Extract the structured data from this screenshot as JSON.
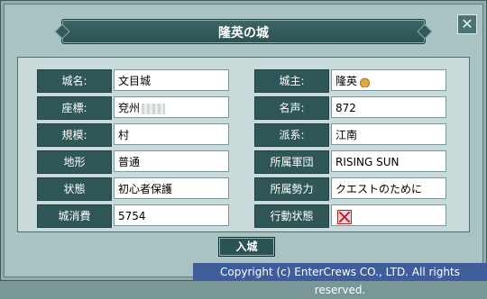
{
  "window": {
    "title": "隆英の城",
    "close_glyph": "✕"
  },
  "fields_left": [
    {
      "label": "城名:",
      "value": "文目城"
    },
    {
      "label": "座標:",
      "value": "兗州"
    },
    {
      "label": "規模:",
      "value": "村"
    },
    {
      "label": "地形",
      "value": "普通"
    },
    {
      "label": "状態",
      "value": "初心者保護"
    },
    {
      "label": "城消費",
      "value": "5754"
    }
  ],
  "fields_right": [
    {
      "label": "城主:",
      "value": "隆英"
    },
    {
      "label": "名声:",
      "value": "872"
    },
    {
      "label": "派系:",
      "value": "江南"
    },
    {
      "label": "所属軍団",
      "value": "RISING SUN"
    },
    {
      "label": "所属勢力",
      "value": "クエストのために"
    },
    {
      "label": "行動状態",
      "value": ""
    }
  ],
  "enter_button": {
    "label": "入城"
  },
  "footer": {
    "copyright": "Copyright (c) EnterCrews CO., LTD. All rights reserved."
  }
}
